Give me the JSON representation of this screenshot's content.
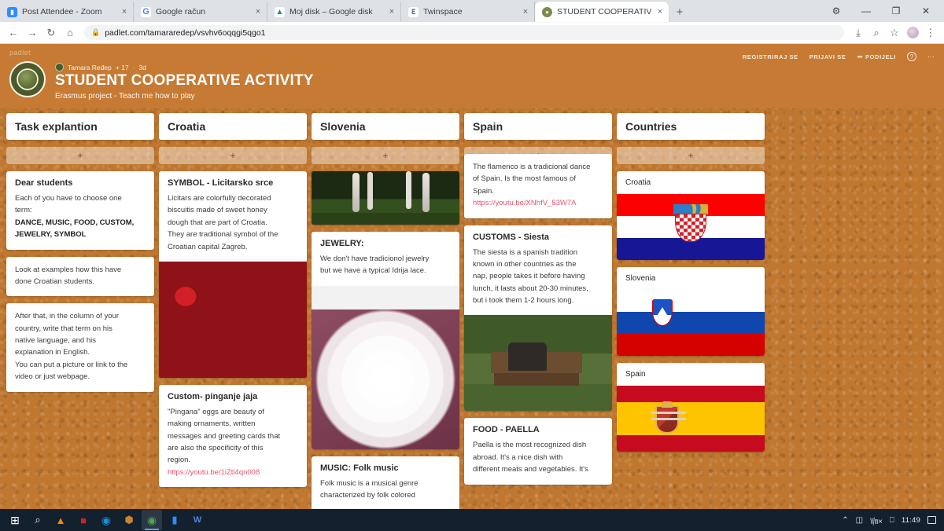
{
  "browser": {
    "tabs": [
      {
        "title": "Post Attendee - Zoom",
        "favicon": "zoom-icon",
        "color": "#2d8cff",
        "glyph": "■",
        "active": false
      },
      {
        "title": "Google račun",
        "favicon": "google-icon",
        "color": "#ffffff",
        "glyph": "G",
        "active": false
      },
      {
        "title": "Moj disk – Google disk",
        "favicon": "google-drive-icon",
        "color": "#ffffff",
        "glyph": "▲",
        "active": false
      },
      {
        "title": "Twinspace",
        "favicon": "twinspace-icon",
        "color": "#ffffff",
        "glyph": "Ɛ",
        "active": false
      },
      {
        "title": "STUDENT COOPERATIVE ACTIVIT",
        "favicon": "padlet-board-icon",
        "color": "#7a8a4a",
        "glyph": "●",
        "active": true
      }
    ],
    "new_tab_label": "+",
    "close_label": "×",
    "window_controls": {
      "settings": "⚙",
      "minimize": "—",
      "maximize": "❐",
      "close": "✕"
    },
    "nav": {
      "back": "←",
      "forward": "→",
      "reload": "↻",
      "home": "⌂"
    },
    "url": "padlet.com/tamararedep/vsvhv6oqqgi5qgo1",
    "lock_icon": "lock-icon",
    "toolbar_right": {
      "install": "⤓",
      "zoom": "⌕",
      "bookmark": "☆",
      "menu": "⋮"
    }
  },
  "padlet": {
    "brand": "padlet",
    "header_actions": {
      "register": "REGISTRIRAJ SE",
      "login": "PRIJAVI SE",
      "share": "PODIJELI",
      "share_icon": "share-arrow-icon",
      "help_icon": "help-circle-icon",
      "more_icon": "more-dots-icon"
    },
    "board": {
      "author": "Tamara Ređep",
      "collaborators": "+ 17",
      "separator": "·",
      "updated": "3d",
      "title": "STUDENT COOPERATIVE ACTIVITY",
      "subtitle": "Erasmus project - Teach me how to play"
    },
    "add_post_label": "+",
    "columns": [
      {
        "name": "task-explanation",
        "title": "Task explantion",
        "cards": [
          {
            "name": "dear-students-card",
            "title": "Dear students",
            "lines": [
              {
                "text": "Each of you have to choose one",
                "bold": false
              },
              {
                "text": "term:",
                "bold": false
              },
              {
                "text": "DANCE,  MUSIC, FOOD,  CUSTOM,",
                "bold": true
              },
              {
                "text": "JEWELRY, SYMBOL",
                "bold": true
              }
            ]
          },
          {
            "name": "examples-card",
            "title": "",
            "lines": [
              {
                "text": "Look at examples how this have",
                "bold": false
              },
              {
                "text": "done Croatian students.",
                "bold": false
              }
            ]
          },
          {
            "name": "instructions-card",
            "title": "",
            "lines": [
              {
                "text": "After that, in the column of your",
                "bold": false
              },
              {
                "text": "country, write that term on his",
                "bold": false
              },
              {
                "text": "native language, and his",
                "bold": false
              },
              {
                "text": "explanation in English.",
                "bold": false
              },
              {
                "text": "You can put a picture or link to the",
                "bold": false
              },
              {
                "text": "video or just webpage.",
                "bold": false
              }
            ]
          }
        ]
      },
      {
        "name": "croatia",
        "title": "Croatia",
        "cards": [
          {
            "name": "symbol-licitarsko-srce-card",
            "title": "SYMBOL - Licitarsko srce",
            "lines": [
              {
                "text": "Licitars are colorfully decorated",
                "bold": false
              },
              {
                "text": "biscuitis made of sweet honey",
                "bold": false
              },
              {
                "text": "dough that are part of Croatia.",
                "bold": false
              },
              {
                "text": "They are traditional symbol of the",
                "bold": false
              },
              {
                "text": "Croatian capital Zagreb.",
                "bold": false
              }
            ],
            "photo": "licitar-hearts-photo"
          },
          {
            "name": "custom-pinganje-jaja-card",
            "title": "Custom- pinganje jaja",
            "lines": [
              {
                "text": "\"Pingana\" eggs are beauty of",
                "bold": false
              },
              {
                "text": "making ornaments, written",
                "bold": false
              },
              {
                "text": "messages and greeting cards that",
                "bold": false
              },
              {
                "text": "are also the specificity of this",
                "bold": false
              },
              {
                "text": "region.",
                "bold": false
              }
            ],
            "link": "https://youtu.be/1iZtl4qn008"
          }
        ]
      },
      {
        "name": "slovenia",
        "title": "Slovenia",
        "cards": [
          {
            "name": "lipizzaner-photo-card",
            "photo": "horse-legs-photo"
          },
          {
            "name": "jewelry-card",
            "title": "JEWELRY:",
            "lines": [
              {
                "text": "We don't have tradicionol jewelry",
                "bold": false
              },
              {
                "text": "but we have a typical Idrija lace.",
                "bold": false
              }
            ],
            "photo": "idrija-lace-photo"
          },
          {
            "name": "music-folk-card",
            "title": "MUSIC: Folk music",
            "lines": [
              {
                "text": "Folk music is a musical genre",
                "bold": false
              },
              {
                "text": "characterized by folk colored",
                "bold": false
              }
            ]
          }
        ]
      },
      {
        "name": "spain",
        "title": "Spain",
        "cards": [
          {
            "name": "flamenco-card",
            "title": "",
            "lines": [
              {
                "text": "The flamenco is a tradicional dance",
                "bold": false
              },
              {
                "text": "of Spain. Is the most famous of",
                "bold": false
              },
              {
                "text": "Spain.",
                "bold": false
              }
            ],
            "link": "https://youtu.be/XNhfV_53W7A"
          },
          {
            "name": "customs-siesta-card",
            "title": "CUSTOMS - Siesta",
            "lines": [
              {
                "text": "The siesta is a spanish tradition",
                "bold": false
              },
              {
                "text": "known in other countries as the",
                "bold": false
              },
              {
                "text": "nap, people takes it before having",
                "bold": false
              },
              {
                "text": "lunch, it lasts about 20-30 minutes,",
                "bold": false
              },
              {
                "text": "but i took them 1-2 hours long.",
                "bold": false
              }
            ],
            "photo": "siesta-bench-photo"
          },
          {
            "name": "food-paella-card",
            "title": "FOOD - PAELLA",
            "lines": [
              {
                "text": "Paella is the most recognized dish",
                "bold": false
              },
              {
                "text": "abroad. It's a nice dish with",
                "bold": false
              },
              {
                "text": "different meats and vegetables. It's",
                "bold": false
              }
            ]
          }
        ]
      },
      {
        "name": "countries",
        "title": "Countries",
        "cards": [
          {
            "name": "croatia-flag-card",
            "label": "Croatia",
            "flag": "croatia-flag"
          },
          {
            "name": "slovenia-flag-card",
            "label": "Slovenia",
            "flag": "slovenia-flag"
          },
          {
            "name": "spain-flag-card",
            "label": "Spain",
            "flag": "spain-flag"
          }
        ]
      }
    ]
  },
  "taskbar": {
    "apps": [
      {
        "name": "start-button",
        "glyph": "⊞",
        "color": "#ffffff",
        "active": false
      },
      {
        "name": "search-icon",
        "glyph": "⌕",
        "color": "#e6e9ec",
        "active": false
      },
      {
        "name": "vlc-icon",
        "glyph": "▲",
        "color": "#ff8800",
        "active": false
      },
      {
        "name": "adobe-reader-icon",
        "glyph": "▬",
        "color": "#cc2229",
        "active": false
      },
      {
        "name": "edge-icon",
        "glyph": "●",
        "color": "#1a8fd1",
        "active": false
      },
      {
        "name": "package-icon",
        "glyph": "⬢",
        "color": "#c8842e",
        "active": false
      },
      {
        "name": "chrome-icon",
        "glyph": "◉",
        "color": "#4fa84f",
        "active": true
      },
      {
        "name": "zoom-icon",
        "glyph": "▬",
        "color": "#2d8cff",
        "active": false
      },
      {
        "name": "word-icon",
        "glyph": "W",
        "color": "#2b579a",
        "active": false
      }
    ],
    "tray": {
      "chevron": "⌃",
      "network_icon": "network-icon",
      "volume_icon": "㏞×",
      "display_icon": "display-icon",
      "clock": "11:49",
      "action_center_icon": "action-center-icon"
    }
  }
}
